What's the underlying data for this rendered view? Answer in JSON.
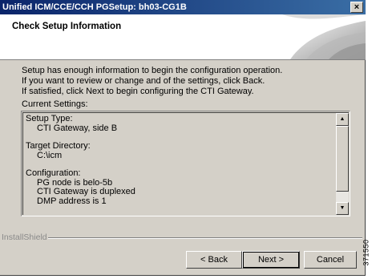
{
  "window": {
    "title": "Unified ICM/CCE/CCH PGSetup: bh03-CG1B",
    "close_glyph": "×"
  },
  "header": {
    "title": "Check Setup Information"
  },
  "intro_lines": [
    "Setup has enough information to begin the configuration operation.",
    "If you want to review or change and of the settings, click Back.",
    "If satisfied, click Next to begin configuring the CTI Gateway."
  ],
  "current_settings_label": "Current Settings:",
  "settings": {
    "setup_type_label": "Setup Type:",
    "setup_type_value": "CTI Gateway, side B",
    "target_dir_label": "Target Directory:",
    "target_dir_value": "C:\\icm",
    "configuration_label": "Configuration:",
    "configuration_lines": [
      "PG node is belo-5b",
      "CTI Gateway is duplexed",
      "DMP address is 1"
    ]
  },
  "scrollbar": {
    "up_glyph": "▲",
    "down_glyph": "▼"
  },
  "footer": {
    "brand": "InstallShield",
    "back_label": "< Back",
    "next_label": "Next >",
    "cancel_label": "Cancel"
  },
  "figure_code": "371550"
}
